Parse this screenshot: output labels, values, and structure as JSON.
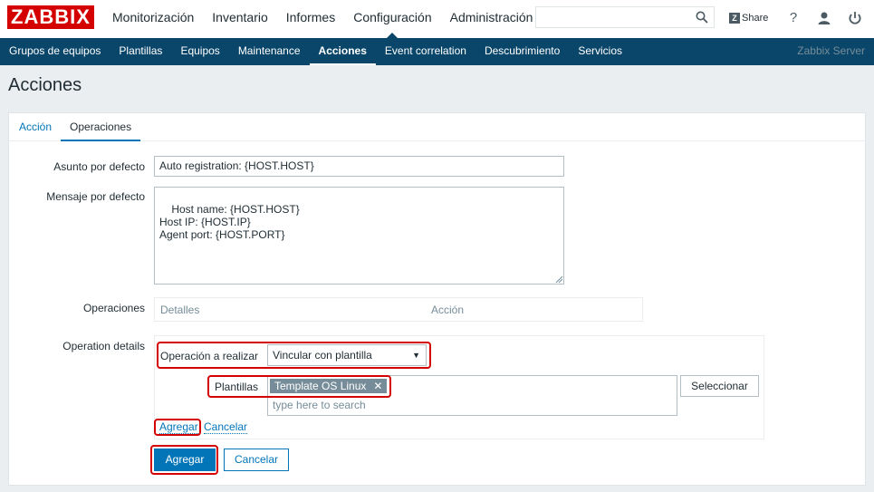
{
  "header": {
    "logo": "ZABBIX",
    "menu": [
      "Monitorización",
      "Inventario",
      "Informes",
      "Configuración",
      "Administración"
    ],
    "active_menu": "Configuración",
    "search_placeholder": "",
    "share_label": "Share",
    "share_badge": "Z",
    "icons": [
      "search-icon",
      "help-icon",
      "user-icon",
      "power-icon"
    ]
  },
  "subnav": {
    "items": [
      "Grupos de equipos",
      "Plantillas",
      "Equipos",
      "Maintenance",
      "Acciones",
      "Event correlation",
      "Descubrimiento",
      "Servicios"
    ],
    "active": "Acciones",
    "server_name": "Zabbix Server"
  },
  "page": {
    "title": "Acciones"
  },
  "tabs": [
    "Acción",
    "Operaciones"
  ],
  "form": {
    "subject_label": "Asunto por defecto",
    "subject_value": "Auto registration: {HOST.HOST}",
    "message_label": "Mensaje por defecto",
    "message_value": "Host name: {HOST.HOST}\nHost IP: {HOST.IP}\nAgent port: {HOST.PORT}",
    "operations_label": "Operaciones",
    "operations_columns": [
      "Detalles",
      "Acción"
    ],
    "details_label": "Operation details",
    "operation_type_label": "Operación a realizar",
    "operation_type_value": "Vincular con plantilla",
    "templates_label": "Plantillas",
    "template_tag": "Template OS Linux",
    "template_search_placeholder": "type here to search",
    "select_button": "Seleccionar",
    "add_link": "Agregar",
    "cancel_link": "Cancelar",
    "add_button": "Agregar",
    "cancel_button": "Cancelar"
  },
  "colors": {
    "brand_red": "#d40000",
    "nav_blue": "#0a466a",
    "link_blue": "#0275b8",
    "highlight": "#d40000"
  }
}
